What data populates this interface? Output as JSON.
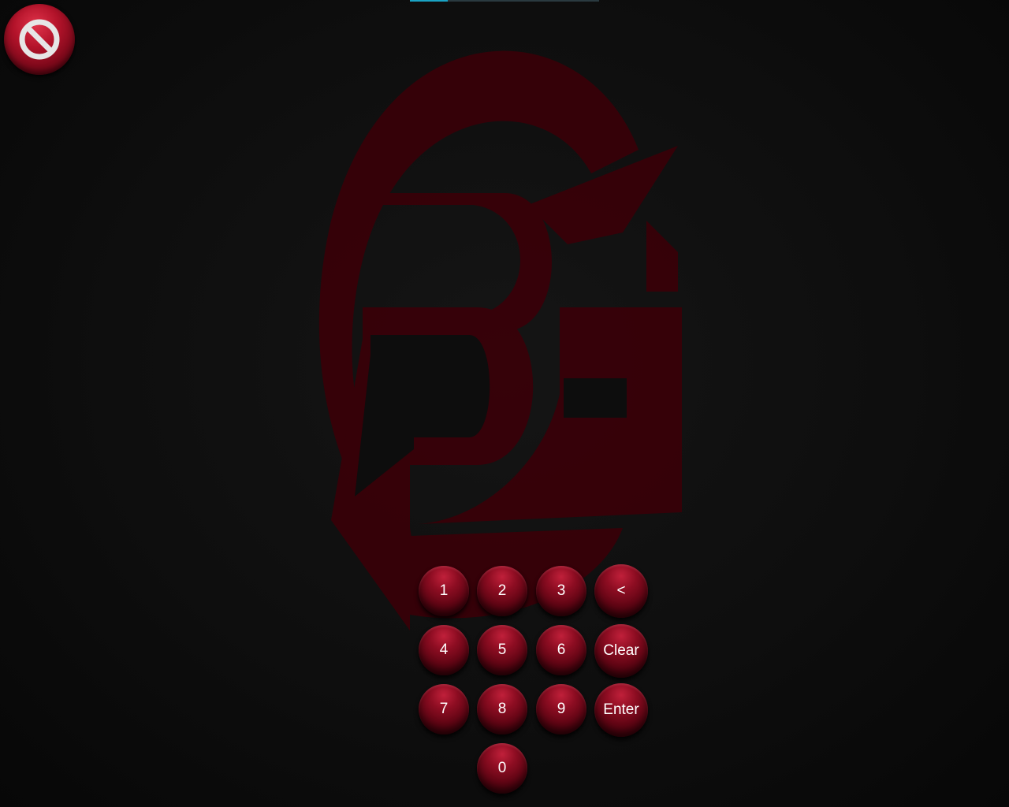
{
  "pin_entry": {
    "progress": 0.2,
    "color": "#1aa3c4"
  },
  "cancel_button": {
    "icon": "no-entry-icon",
    "color": "#b3132a"
  },
  "logo": {
    "icon": "pg-logo-icon",
    "color": "#3a0008"
  },
  "keypad": {
    "keys": {
      "k1": "1",
      "k2": "2",
      "k3": "3",
      "backspace": "<",
      "k4": "4",
      "k5": "5",
      "k6": "6",
      "clear": "Clear",
      "k7": "7",
      "k8": "8",
      "k9": "9",
      "enter": "Enter",
      "k0": "0"
    },
    "key_color": "#8d0d22"
  }
}
